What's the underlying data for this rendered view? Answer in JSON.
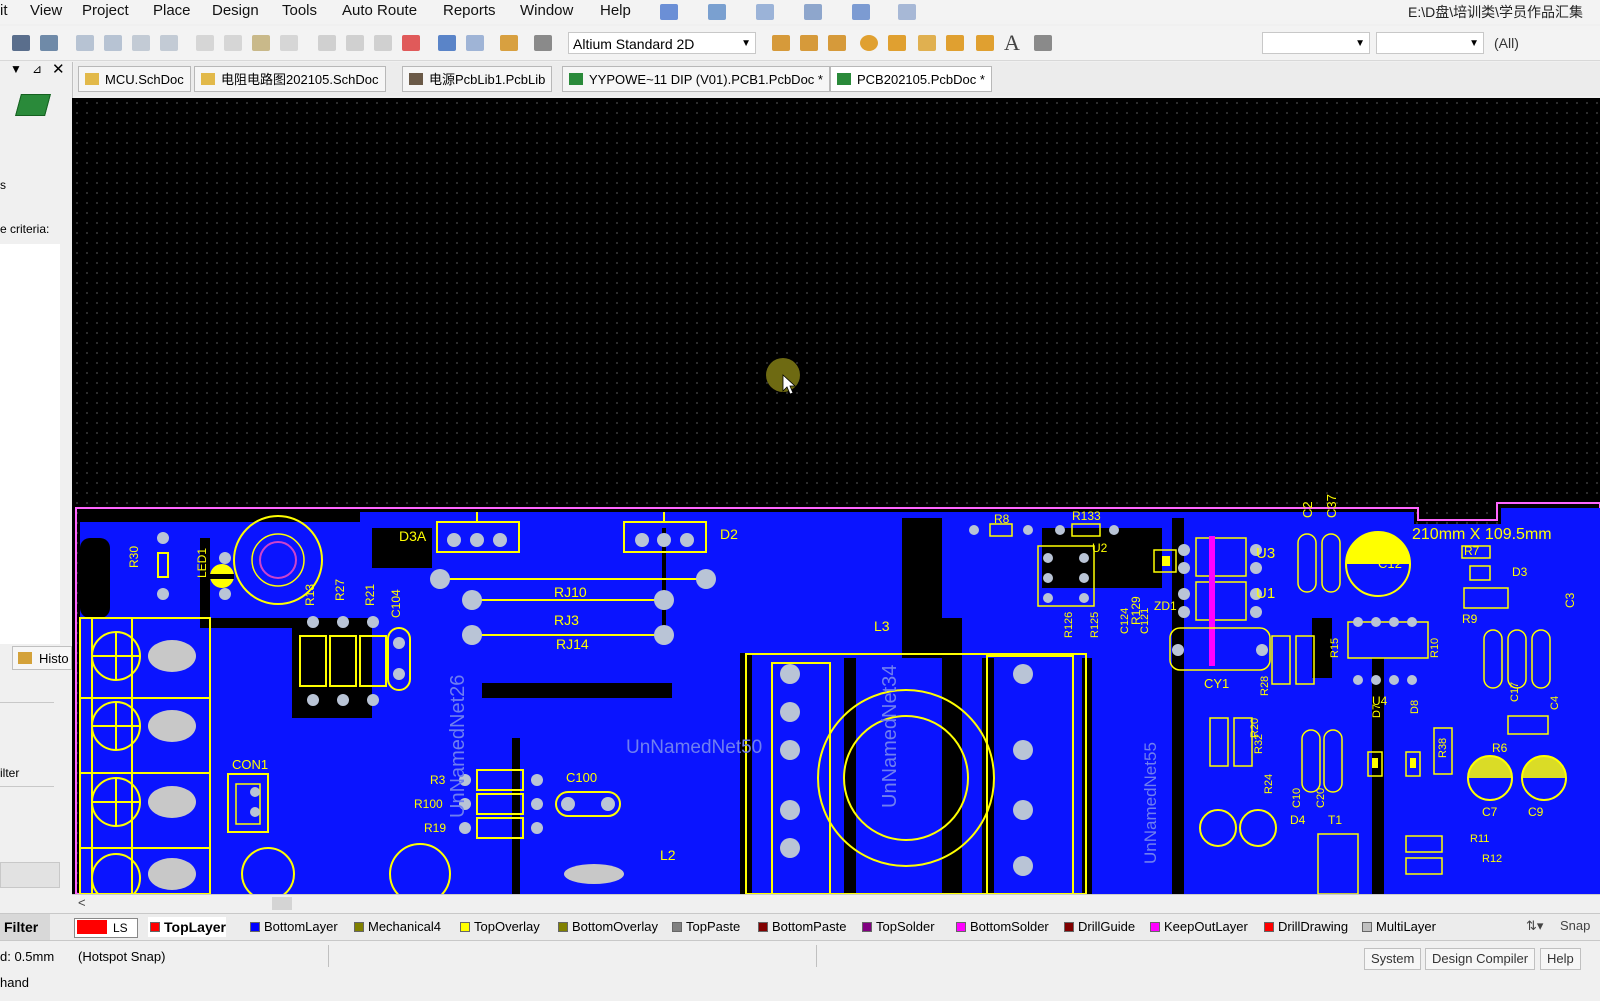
{
  "menu": {
    "items": [
      "it",
      "View",
      "Project",
      "Place",
      "Design",
      "Tools",
      "Auto Route",
      "Reports",
      "Window",
      "Help"
    ],
    "path": "E:\\D盘\\培训类\\学员作品汇集"
  },
  "toolbar": {
    "view_mode": "Altium Standard 2D",
    "filter_all": "(All)"
  },
  "tabs": [
    {
      "label": "MCU.SchDoc",
      "type": "sch"
    },
    {
      "label": "电阻电路图202105.SchDoc",
      "type": "sch"
    },
    {
      "label": "电源PcbLib1.PcbLib",
      "type": "lib"
    },
    {
      "label": "YYPOWE~11 DIP (V01).PCB1.PcbDoc *",
      "type": "pcb"
    },
    {
      "label": "PCB202105.PcbDoc *",
      "type": "pcb"
    }
  ],
  "left_panel": {
    "label_s": "s",
    "criteria": "e criteria:",
    "history": "Histo",
    "filter": "ilter"
  },
  "pcb": {
    "dimension_label": "210mm X 109.5mm",
    "components": [
      "D3A",
      "D2",
      "RJ10",
      "RJ3",
      "RJ14",
      "L3",
      "L2",
      "CON1",
      "R3",
      "R100",
      "R19",
      "C100",
      "R30",
      "LED1",
      "R13",
      "R27",
      "R21",
      "C104",
      "R8",
      "R133",
      "U2",
      "ZD1",
      "R129",
      "U3",
      "U1",
      "CY1",
      "C2",
      "C37",
      "C12",
      "R7",
      "D3",
      "R9",
      "C3",
      "R15",
      "U4",
      "R28",
      "R10",
      "C4",
      "C17",
      "R6",
      "C7",
      "C9",
      "R11",
      "R12",
      "T1",
      "D4",
      "C10",
      "C20",
      "R24",
      "R20",
      "R32",
      "D7",
      "D8",
      "R38",
      "R126",
      "R125",
      "C124",
      "C121"
    ],
    "nets": [
      "UnNamedNet26",
      "UnNamedNet50",
      "UnNamedNet34",
      "UnNamedNet55"
    ]
  },
  "layers": {
    "filter_label": "Filter",
    "ls_label": "LS",
    "snap_label": "Snap",
    "items": [
      {
        "label": "TopLayer",
        "color": "#ff0000",
        "active": true
      },
      {
        "label": "BottomLayer",
        "color": "#0000ff",
        "active": false
      },
      {
        "label": "Mechanical4",
        "color": "#808000",
        "active": false
      },
      {
        "label": "TopOverlay",
        "color": "#ffff00",
        "active": false
      },
      {
        "label": "BottomOverlay",
        "color": "#808000",
        "active": false
      },
      {
        "label": "TopPaste",
        "color": "#808080",
        "active": false
      },
      {
        "label": "BottomPaste",
        "color": "#800000",
        "active": false
      },
      {
        "label": "TopSolder",
        "color": "#800080",
        "active": false
      },
      {
        "label": "BottomSolder",
        "color": "#ff00ff",
        "active": false
      },
      {
        "label": "DrillGuide",
        "color": "#800000",
        "active": false
      },
      {
        "label": "KeepOutLayer",
        "color": "#ff00ff",
        "active": false
      },
      {
        "label": "DrillDrawing",
        "color": "#ff0000",
        "active": false
      },
      {
        "label": "MultiLayer",
        "color": "#c0c0c0",
        "active": false
      }
    ]
  },
  "status": {
    "grid": "d: 0.5mm",
    "snap": "(Hotspot Snap)",
    "hand": "hand",
    "buttons": [
      "System",
      "Design Compiler",
      "Help"
    ]
  },
  "colors": {
    "canvas_bg": "#000000",
    "copper": "#0000ff",
    "overlay": "#ffff00",
    "board_edge": "#ff66ff"
  }
}
